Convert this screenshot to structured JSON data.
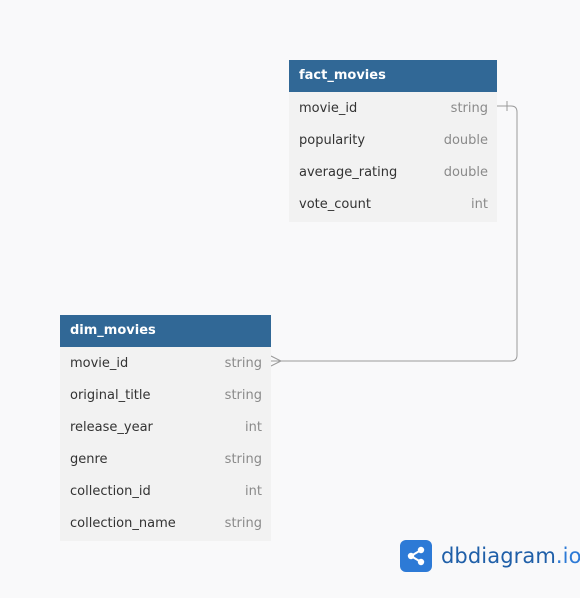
{
  "tables": {
    "fact_movies": {
      "title": "fact_movies",
      "fields": [
        {
          "name": "movie_id",
          "type": "string"
        },
        {
          "name": "popularity",
          "type": "double"
        },
        {
          "name": "average_rating",
          "type": "double"
        },
        {
          "name": "vote_count",
          "type": "int"
        }
      ]
    },
    "dim_movies": {
      "title": "dim_movies",
      "fields": [
        {
          "name": "movie_id",
          "type": "string"
        },
        {
          "name": "original_title",
          "type": "string"
        },
        {
          "name": "release_year",
          "type": "int"
        },
        {
          "name": "genre",
          "type": "string"
        },
        {
          "name": "collection_id",
          "type": "int"
        },
        {
          "name": "collection_name",
          "type": "string"
        }
      ]
    }
  },
  "relationships": [
    {
      "from": "fact_movies.movie_id",
      "to": "dim_movies.movie_id",
      "from_cardinality": "one",
      "to_cardinality": "many"
    }
  ],
  "brand": {
    "name": "dbdiagram",
    "tld": ".io",
    "icon": "share-nodes-icon"
  },
  "colors": {
    "header": "#316896",
    "row_bg": "#f2f2f2",
    "connector": "#9a9a9a",
    "brand": "#2d7ad6"
  }
}
